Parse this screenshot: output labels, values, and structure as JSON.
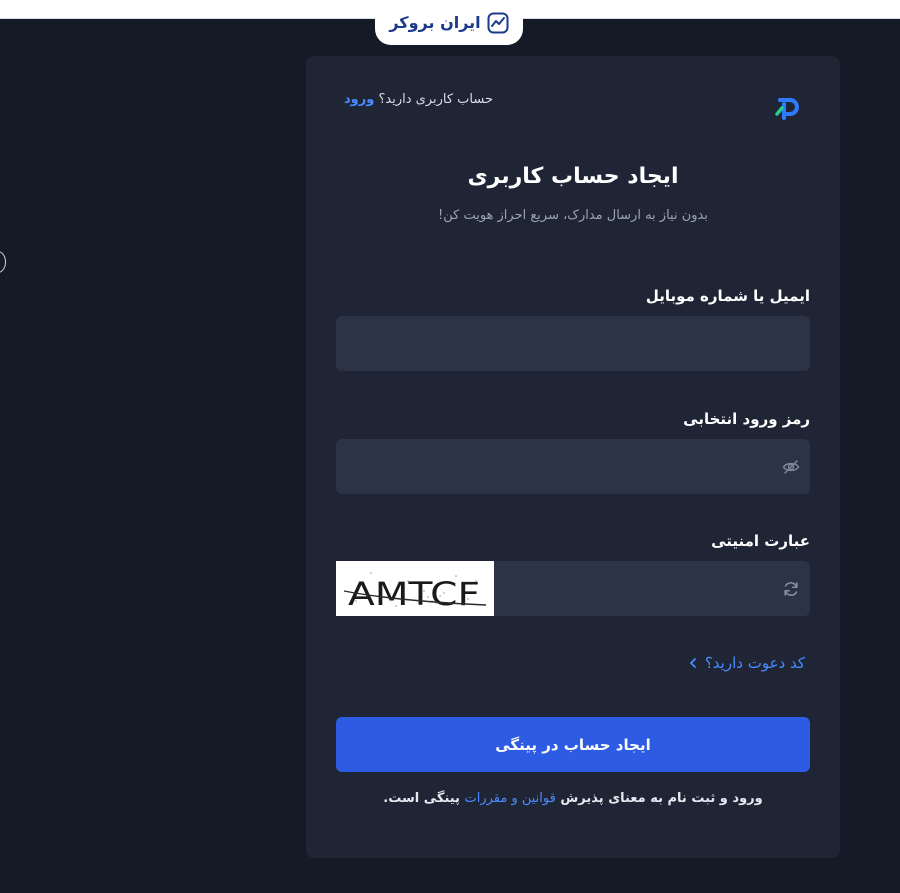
{
  "brand": {
    "name": "ایران بروکر"
  },
  "header": {
    "have_account_text": "حساب کاربری دارید؟",
    "login_link": "ورود"
  },
  "title": "ایجاد حساب کاربری",
  "subtitle": "بدون نیاز به ارسال مدارک، سریع احراز هویت کن!",
  "fields": {
    "email_label": "ایمیل یا شماره موبایل",
    "email_value": "",
    "password_label": "رمز ورود انتخابی",
    "password_value": "",
    "captcha_label": "عبارت امنیتی",
    "captcha_value": "",
    "captcha_text": "AMTCF"
  },
  "invite_link": "کد دعوت دارید؟",
  "submit_label": "ایجاد حساب در پینگی",
  "terms": {
    "prefix": "ورود و ثبت نام به معنای پذیرش ",
    "link": "قوانین و مقررات",
    "suffix": " پینگی است."
  },
  "colors": {
    "background": "#141a26",
    "card": "#1f2535",
    "field": "#2c3346",
    "accent": "#2d5be3",
    "link": "#4a8cff"
  },
  "icons": [
    "trend-chart-icon",
    "pingi-logo-icon",
    "eye-off-icon",
    "refresh-icon",
    "chevron-left-icon"
  ]
}
